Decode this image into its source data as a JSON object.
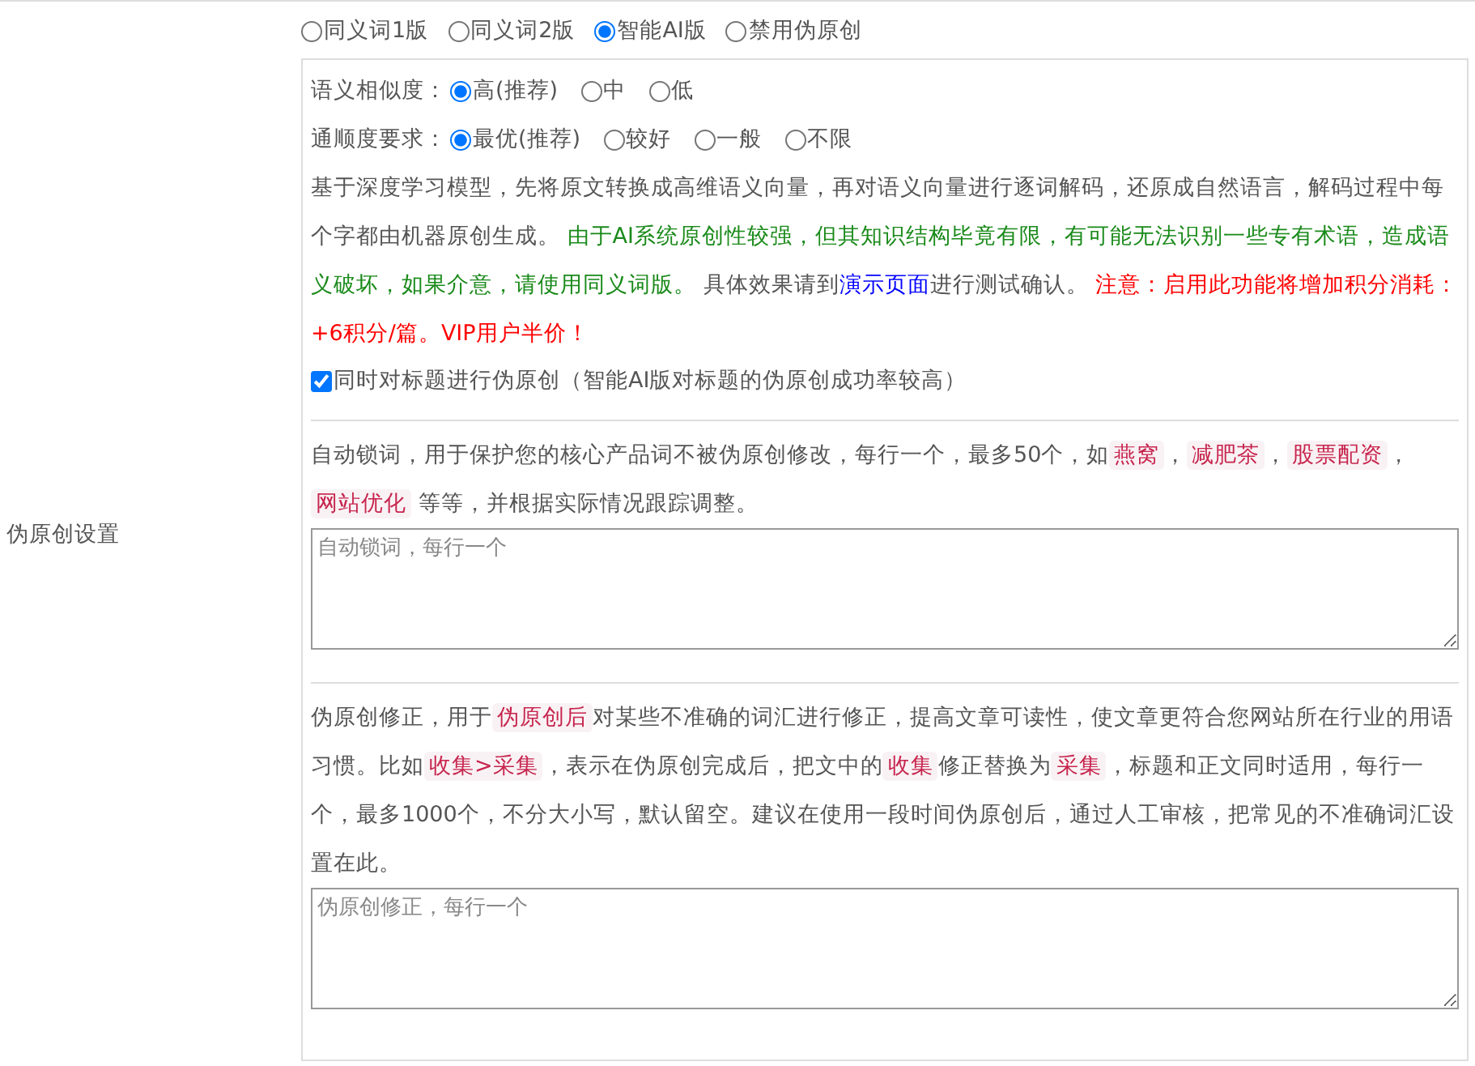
{
  "section_label": "伪原创设置",
  "modes": [
    {
      "label": "同义词1版",
      "selected": false
    },
    {
      "label": "同义词2版",
      "selected": false
    },
    {
      "label": "智能AI版",
      "selected": true
    },
    {
      "label": "禁用伪原创",
      "selected": false
    }
  ],
  "similarity": {
    "label": "语义相似度：",
    "options": [
      {
        "label": "高(推荐)",
        "selected": true
      },
      {
        "label": "中",
        "selected": false
      },
      {
        "label": "低",
        "selected": false
      }
    ]
  },
  "fluency": {
    "label": "通顺度要求：",
    "options": [
      {
        "label": "最优(推荐)",
        "selected": true
      },
      {
        "label": "较好",
        "selected": false
      },
      {
        "label": "一般",
        "selected": false
      },
      {
        "label": "不限",
        "selected": false
      }
    ]
  },
  "ai_description": [
    {
      "kind": "text",
      "text": "基于深度学习模型，先将原文转换成高维语义向量，再对语义向量进行逐词解码，还原成自然语言，解码过程中每个字都由机器原创生成。 "
    },
    {
      "kind": "note",
      "text": "由于AI系统原创性较强，但其知识结构毕竟有限，有可能无法识别一些专有术语，造成语义破坏，如果介意，请使用同义词版。"
    },
    {
      "kind": "text",
      "text": " 具体效果请到"
    },
    {
      "kind": "link",
      "text": "演示页面"
    },
    {
      "kind": "text",
      "text": "进行测试确认。 "
    },
    {
      "kind": "warning",
      "text": "注意：启用此功能将增加积分消耗：+6积分/篇。VIP用户半价！"
    }
  ],
  "title_option": {
    "label": "同时对标题进行伪原创（智能AI版对标题的伪原创成功率较高）",
    "checked": true
  },
  "lock_words": {
    "description": [
      {
        "kind": "text",
        "text": "自动锁词，用于保护您的核心产品词不被伪原创修改，每行一个，最多50个，如"
      },
      {
        "kind": "code",
        "text": "燕窝"
      },
      {
        "kind": "text",
        "text": "，"
      },
      {
        "kind": "code",
        "text": "减肥茶"
      },
      {
        "kind": "text",
        "text": "，"
      },
      {
        "kind": "code",
        "text": "股票配资"
      },
      {
        "kind": "text",
        "text": "，"
      },
      {
        "kind": "code",
        "text": "网站优化"
      },
      {
        "kind": "text",
        "text": " 等等，并根据实际情况跟踪调整。"
      }
    ],
    "placeholder": "自动锁词，每行一个"
  },
  "corrections": {
    "description": [
      {
        "kind": "text",
        "text": "伪原创修正，用于"
      },
      {
        "kind": "code",
        "text": "伪原创后"
      },
      {
        "kind": "text",
        "text": "对某些不准确的词汇进行修正，提高文章可读性，使文章更符合您网站所在行业的用语习惯。比如"
      },
      {
        "kind": "code",
        "text": "收集>采集"
      },
      {
        "kind": "text",
        "text": "，表示在伪原创完成后，把文中的"
      },
      {
        "kind": "code",
        "text": "收集"
      },
      {
        "kind": "text",
        "text": "修正替换为"
      },
      {
        "kind": "code",
        "text": "采集"
      },
      {
        "kind": "text",
        "text": "，标题和正文同时适用，每行一个，最多1000个，不分大小写，默认留空。建议在使用一段时间伪原创后，通过人工审核，把常见的不准确词汇设置在此。"
      }
    ],
    "placeholder": "伪原创修正，每行一个"
  }
}
